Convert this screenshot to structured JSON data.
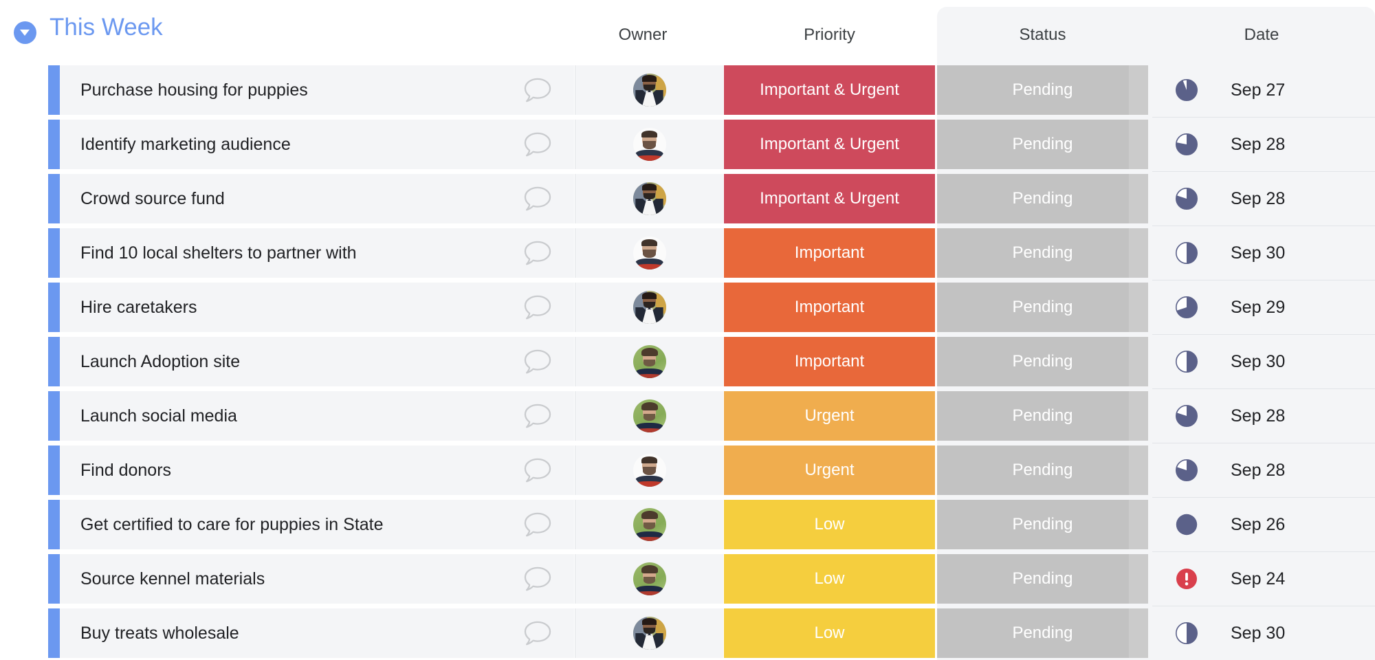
{
  "header": {
    "collapse_icon": "chevron-down-circle-icon",
    "group_title": "This Week",
    "columns": {
      "owner": "Owner",
      "priority": "Priority",
      "status": "Status",
      "date": "Date"
    }
  },
  "colors": {
    "accent_blue": "#6b98f0",
    "row_bg": "#f4f5f7",
    "status_cell": "#c2c2c2",
    "priority_important_urgent": "#ce4a5c",
    "priority_important": "#e8683a",
    "priority_urgent": "#f0ad4e",
    "priority_low": "#f5ce3e",
    "date_icon": "#5b6189",
    "date_icon_overdue": "#d93f4c",
    "panel_bg": "#f4f5f7"
  },
  "rows": [
    {
      "task": "Purchase housing for puppies",
      "comment_icon": "comment-bubble-icon",
      "owner_avatar": "a",
      "priority": "Important & Urgent",
      "priority_color": "#ce4a5c",
      "status": "Pending",
      "date": "Sep 27",
      "date_icon": "pie-progress-icon",
      "date_icon_fill_pct": 94,
      "overdue": false
    },
    {
      "task": "Identify marketing audience",
      "comment_icon": "comment-bubble-icon",
      "owner_avatar": "b",
      "priority": "Important & Urgent",
      "priority_color": "#ce4a5c",
      "status": "Pending",
      "date": "Sep 28",
      "date_icon": "pie-progress-icon",
      "date_icon_fill_pct": 78,
      "overdue": false
    },
    {
      "task": "Crowd source fund",
      "comment_icon": "comment-bubble-icon",
      "owner_avatar": "a",
      "priority": "Important & Urgent",
      "priority_color": "#ce4a5c",
      "status": "Pending",
      "date": "Sep 28",
      "date_icon": "pie-progress-icon",
      "date_icon_fill_pct": 80,
      "overdue": false
    },
    {
      "task": "Find 10 local shelters to partner with",
      "comment_icon": "comment-bubble-icon",
      "owner_avatar": "b",
      "priority": "Important",
      "priority_color": "#e8683a",
      "status": "Pending",
      "date": "Sep 30",
      "date_icon": "pie-progress-icon",
      "date_icon_fill_pct": 50,
      "overdue": false
    },
    {
      "task": "Hire caretakers",
      "comment_icon": "comment-bubble-icon",
      "owner_avatar": "a",
      "priority": "Important",
      "priority_color": "#e8683a",
      "status": "Pending",
      "date": "Sep 29",
      "date_icon": "pie-progress-icon",
      "date_icon_fill_pct": 70,
      "overdue": false
    },
    {
      "task": "Launch Adoption site",
      "comment_icon": "comment-bubble-icon",
      "owner_avatar": "c",
      "priority": "Important",
      "priority_color": "#e8683a",
      "status": "Pending",
      "date": "Sep 30",
      "date_icon": "pie-progress-icon",
      "date_icon_fill_pct": 50,
      "overdue": false
    },
    {
      "task": "Launch social media",
      "comment_icon": "comment-bubble-icon",
      "owner_avatar": "c",
      "priority": "Urgent",
      "priority_color": "#f0ad4e",
      "status": "Pending",
      "date": "Sep 28",
      "date_icon": "pie-progress-icon",
      "date_icon_fill_pct": 80,
      "overdue": false
    },
    {
      "task": "Find donors",
      "comment_icon": "comment-bubble-icon",
      "owner_avatar": "b",
      "priority": "Urgent",
      "priority_color": "#f0ad4e",
      "status": "Pending",
      "date": "Sep 28",
      "date_icon": "pie-progress-icon",
      "date_icon_fill_pct": 80,
      "overdue": false
    },
    {
      "task": "Get certified to care for puppies in State",
      "comment_icon": "comment-bubble-icon",
      "owner_avatar": "c",
      "priority": "Low",
      "priority_color": "#f5ce3e",
      "status": "Pending",
      "date": "Sep 26",
      "date_icon": "pie-progress-icon",
      "date_icon_fill_pct": 100,
      "overdue": false
    },
    {
      "task": "Source kennel materials",
      "comment_icon": "comment-bubble-icon",
      "owner_avatar": "c",
      "priority": "Low",
      "priority_color": "#f5ce3e",
      "status": "Pending",
      "date": "Sep 24",
      "date_icon": "alert-exclamation-icon",
      "date_icon_fill_pct": 100,
      "overdue": true
    },
    {
      "task": "Buy treats wholesale",
      "comment_icon": "comment-bubble-icon",
      "owner_avatar": "a",
      "priority": "Low",
      "priority_color": "#f5ce3e",
      "status": "Pending",
      "date": "Sep 30",
      "date_icon": "pie-progress-icon",
      "date_icon_fill_pct": 50,
      "overdue": false
    }
  ]
}
